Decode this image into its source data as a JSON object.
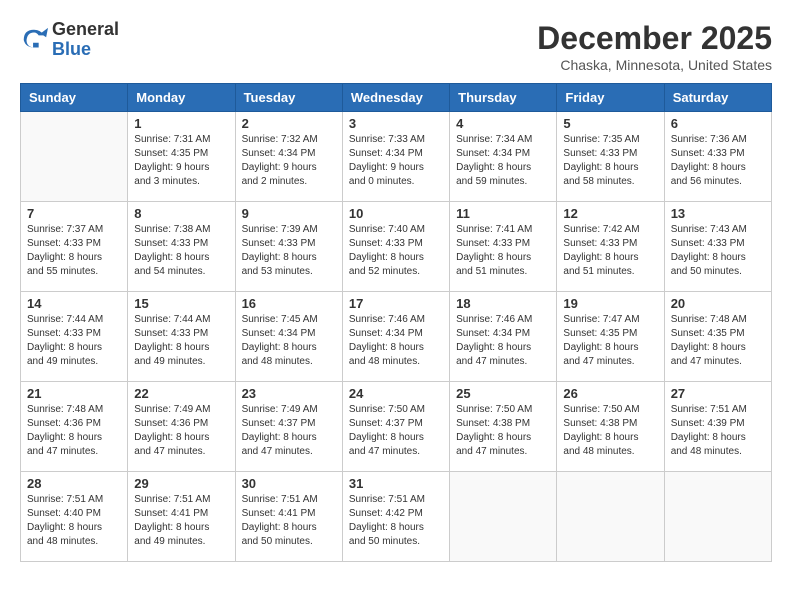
{
  "logo": {
    "general": "General",
    "blue": "Blue"
  },
  "header": {
    "month": "December 2025",
    "location": "Chaska, Minnesota, United States"
  },
  "weekdays": [
    "Sunday",
    "Monday",
    "Tuesday",
    "Wednesday",
    "Thursday",
    "Friday",
    "Saturday"
  ],
  "weeks": [
    [
      {
        "day": "",
        "sunrise": "",
        "sunset": "",
        "daylight": ""
      },
      {
        "day": "1",
        "sunrise": "Sunrise: 7:31 AM",
        "sunset": "Sunset: 4:35 PM",
        "daylight": "Daylight: 9 hours and 3 minutes."
      },
      {
        "day": "2",
        "sunrise": "Sunrise: 7:32 AM",
        "sunset": "Sunset: 4:34 PM",
        "daylight": "Daylight: 9 hours and 2 minutes."
      },
      {
        "day": "3",
        "sunrise": "Sunrise: 7:33 AM",
        "sunset": "Sunset: 4:34 PM",
        "daylight": "Daylight: 9 hours and 0 minutes."
      },
      {
        "day": "4",
        "sunrise": "Sunrise: 7:34 AM",
        "sunset": "Sunset: 4:34 PM",
        "daylight": "Daylight: 8 hours and 59 minutes."
      },
      {
        "day": "5",
        "sunrise": "Sunrise: 7:35 AM",
        "sunset": "Sunset: 4:33 PM",
        "daylight": "Daylight: 8 hours and 58 minutes."
      },
      {
        "day": "6",
        "sunrise": "Sunrise: 7:36 AM",
        "sunset": "Sunset: 4:33 PM",
        "daylight": "Daylight: 8 hours and 56 minutes."
      }
    ],
    [
      {
        "day": "7",
        "sunrise": "Sunrise: 7:37 AM",
        "sunset": "Sunset: 4:33 PM",
        "daylight": "Daylight: 8 hours and 55 minutes."
      },
      {
        "day": "8",
        "sunrise": "Sunrise: 7:38 AM",
        "sunset": "Sunset: 4:33 PM",
        "daylight": "Daylight: 8 hours and 54 minutes."
      },
      {
        "day": "9",
        "sunrise": "Sunrise: 7:39 AM",
        "sunset": "Sunset: 4:33 PM",
        "daylight": "Daylight: 8 hours and 53 minutes."
      },
      {
        "day": "10",
        "sunrise": "Sunrise: 7:40 AM",
        "sunset": "Sunset: 4:33 PM",
        "daylight": "Daylight: 8 hours and 52 minutes."
      },
      {
        "day": "11",
        "sunrise": "Sunrise: 7:41 AM",
        "sunset": "Sunset: 4:33 PM",
        "daylight": "Daylight: 8 hours and 51 minutes."
      },
      {
        "day": "12",
        "sunrise": "Sunrise: 7:42 AM",
        "sunset": "Sunset: 4:33 PM",
        "daylight": "Daylight: 8 hours and 51 minutes."
      },
      {
        "day": "13",
        "sunrise": "Sunrise: 7:43 AM",
        "sunset": "Sunset: 4:33 PM",
        "daylight": "Daylight: 8 hours and 50 minutes."
      }
    ],
    [
      {
        "day": "14",
        "sunrise": "Sunrise: 7:44 AM",
        "sunset": "Sunset: 4:33 PM",
        "daylight": "Daylight: 8 hours and 49 minutes."
      },
      {
        "day": "15",
        "sunrise": "Sunrise: 7:44 AM",
        "sunset": "Sunset: 4:33 PM",
        "daylight": "Daylight: 8 hours and 49 minutes."
      },
      {
        "day": "16",
        "sunrise": "Sunrise: 7:45 AM",
        "sunset": "Sunset: 4:34 PM",
        "daylight": "Daylight: 8 hours and 48 minutes."
      },
      {
        "day": "17",
        "sunrise": "Sunrise: 7:46 AM",
        "sunset": "Sunset: 4:34 PM",
        "daylight": "Daylight: 8 hours and 48 minutes."
      },
      {
        "day": "18",
        "sunrise": "Sunrise: 7:46 AM",
        "sunset": "Sunset: 4:34 PM",
        "daylight": "Daylight: 8 hours and 47 minutes."
      },
      {
        "day": "19",
        "sunrise": "Sunrise: 7:47 AM",
        "sunset": "Sunset: 4:35 PM",
        "daylight": "Daylight: 8 hours and 47 minutes."
      },
      {
        "day": "20",
        "sunrise": "Sunrise: 7:48 AM",
        "sunset": "Sunset: 4:35 PM",
        "daylight": "Daylight: 8 hours and 47 minutes."
      }
    ],
    [
      {
        "day": "21",
        "sunrise": "Sunrise: 7:48 AM",
        "sunset": "Sunset: 4:36 PM",
        "daylight": "Daylight: 8 hours and 47 minutes."
      },
      {
        "day": "22",
        "sunrise": "Sunrise: 7:49 AM",
        "sunset": "Sunset: 4:36 PM",
        "daylight": "Daylight: 8 hours and 47 minutes."
      },
      {
        "day": "23",
        "sunrise": "Sunrise: 7:49 AM",
        "sunset": "Sunset: 4:37 PM",
        "daylight": "Daylight: 8 hours and 47 minutes."
      },
      {
        "day": "24",
        "sunrise": "Sunrise: 7:50 AM",
        "sunset": "Sunset: 4:37 PM",
        "daylight": "Daylight: 8 hours and 47 minutes."
      },
      {
        "day": "25",
        "sunrise": "Sunrise: 7:50 AM",
        "sunset": "Sunset: 4:38 PM",
        "daylight": "Daylight: 8 hours and 47 minutes."
      },
      {
        "day": "26",
        "sunrise": "Sunrise: 7:50 AM",
        "sunset": "Sunset: 4:38 PM",
        "daylight": "Daylight: 8 hours and 48 minutes."
      },
      {
        "day": "27",
        "sunrise": "Sunrise: 7:51 AM",
        "sunset": "Sunset: 4:39 PM",
        "daylight": "Daylight: 8 hours and 48 minutes."
      }
    ],
    [
      {
        "day": "28",
        "sunrise": "Sunrise: 7:51 AM",
        "sunset": "Sunset: 4:40 PM",
        "daylight": "Daylight: 8 hours and 48 minutes."
      },
      {
        "day": "29",
        "sunrise": "Sunrise: 7:51 AM",
        "sunset": "Sunset: 4:41 PM",
        "daylight": "Daylight: 8 hours and 49 minutes."
      },
      {
        "day": "30",
        "sunrise": "Sunrise: 7:51 AM",
        "sunset": "Sunset: 4:41 PM",
        "daylight": "Daylight: 8 hours and 50 minutes."
      },
      {
        "day": "31",
        "sunrise": "Sunrise: 7:51 AM",
        "sunset": "Sunset: 4:42 PM",
        "daylight": "Daylight: 8 hours and 50 minutes."
      },
      {
        "day": "",
        "sunrise": "",
        "sunset": "",
        "daylight": ""
      },
      {
        "day": "",
        "sunrise": "",
        "sunset": "",
        "daylight": ""
      },
      {
        "day": "",
        "sunrise": "",
        "sunset": "",
        "daylight": ""
      }
    ]
  ]
}
